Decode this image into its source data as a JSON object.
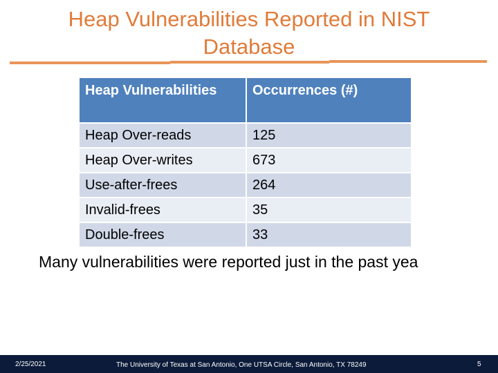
{
  "slide": {
    "title": "Heap Vulnerabilities Reported in NIST Database",
    "accent_color": "#e07b39",
    "table": {
      "header_color": "#4f81bd",
      "headers": [
        "Heap Vulnerabilities",
        "Occurrences (#)"
      ],
      "rows": [
        {
          "name": "Heap Over-reads",
          "count": "125"
        },
        {
          "name": "Heap Over-writes",
          "count": "673"
        },
        {
          "name": "Use-after-frees",
          "count": "264"
        },
        {
          "name": "Invalid-frees",
          "count": "35"
        },
        {
          "name": "Double-frees",
          "count": "33"
        }
      ]
    },
    "caption": "Many vulnerabilities were reported just in the past yea"
  },
  "footer": {
    "date": "2/25/2021",
    "address": "The University of Texas at San Antonio, One UTSA Circle, San Antonio, TX 78249",
    "page_number": "5",
    "background_color": "#0c1b3a"
  }
}
